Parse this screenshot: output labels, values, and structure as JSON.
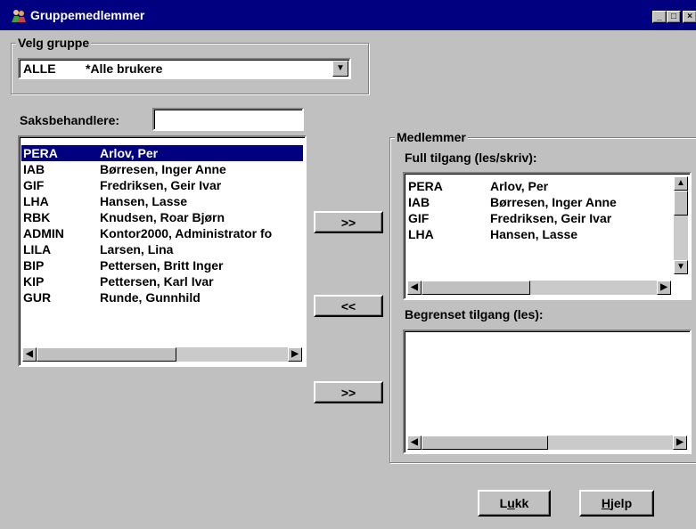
{
  "window": {
    "title": "Gruppemedlemmer",
    "minimize": "_",
    "maximize": "□",
    "close": "×"
  },
  "group_select": {
    "label": "Velg gruppe",
    "selected_code": "ALLE",
    "selected_name": "*Alle brukere"
  },
  "saksbehandlere": {
    "label": "Saksbehandlere:",
    "search_value": "",
    "items": [
      {
        "code": "PERA",
        "name": "Arlov, Per",
        "selected": true
      },
      {
        "code": "IAB",
        "name": "Børresen, Inger Anne"
      },
      {
        "code": "GIF",
        "name": "Fredriksen, Geir Ivar"
      },
      {
        "code": "LHA",
        "name": "Hansen, Lasse"
      },
      {
        "code": "RBK",
        "name": "Knudsen, Roar Bjørn"
      },
      {
        "code": "ADMIN",
        "name": "Kontor2000, Administrator fo"
      },
      {
        "code": "LILA",
        "name": "Larsen, Lina"
      },
      {
        "code": "BIP",
        "name": "Pettersen, Britt Inger"
      },
      {
        "code": "KIP",
        "name": "Pettersen, Karl Ivar"
      },
      {
        "code": "GUR",
        "name": "Runde, Gunnhild"
      }
    ]
  },
  "transfer": {
    "add_full": ">>",
    "remove": "<<",
    "add_limited": ">>"
  },
  "medlemmer": {
    "label": "Medlemmer",
    "full_label": "Full tilgang (les/skriv):",
    "full_items": [
      {
        "code": "PERA",
        "name": "Arlov, Per"
      },
      {
        "code": "IAB",
        "name": "Børresen, Inger Anne"
      },
      {
        "code": "GIF",
        "name": "Fredriksen, Geir Ivar"
      },
      {
        "code": "LHA",
        "name": "Hansen, Lasse"
      }
    ],
    "limited_label": "Begrenset tilgang (les):",
    "limited_items": []
  },
  "buttons": {
    "close_pre": "L",
    "close_u": "u",
    "close_post": "kk",
    "help_u": "H",
    "help_post": "jelp"
  },
  "icons": {
    "app": "group-users-icon",
    "dropdown": "chevron-down-icon",
    "scroll_left": "arrow-left-icon",
    "scroll_right": "arrow-right-icon",
    "scroll_up": "arrow-up-icon",
    "scroll_down": "arrow-down-icon"
  },
  "colors": {
    "title_bar": "#000080",
    "face": "#c0c0c0",
    "selection": "#000080"
  }
}
